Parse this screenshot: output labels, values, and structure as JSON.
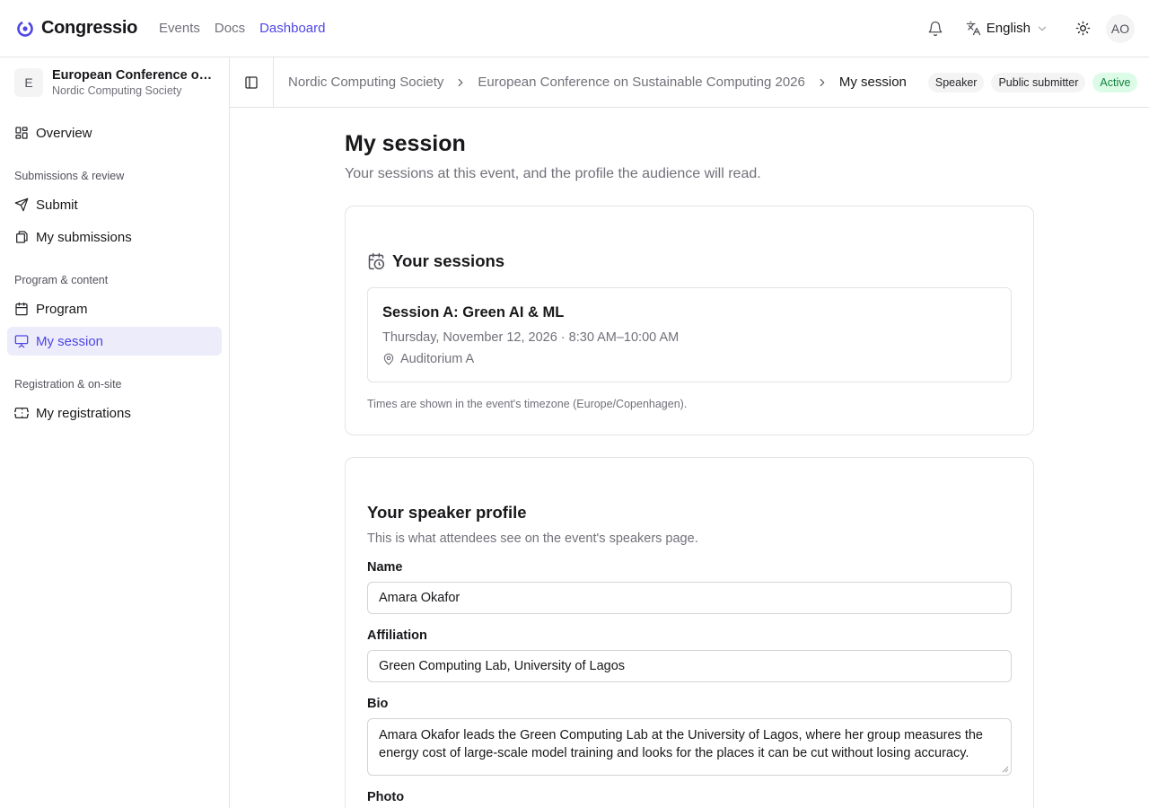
{
  "app": {
    "name": "Congressio"
  },
  "topnav": {
    "events": "Events",
    "docs": "Docs",
    "dashboard": "Dashboard"
  },
  "header": {
    "language": "English",
    "avatar_initials": "AO"
  },
  "sidebar": {
    "event_initial": "E",
    "event_name": "European Conference on Sustainable Computing 2026",
    "event_org": "Nordic Computing Society",
    "overview": "Overview",
    "group_submissions": "Submissions & review",
    "submit": "Submit",
    "my_submissions": "My submissions",
    "group_program": "Program & content",
    "program": "Program",
    "my_session": "My session",
    "group_registration": "Registration & on-site",
    "my_registrations": "My registrations"
  },
  "breadcrumb": {
    "org": "Nordic Computing Society",
    "event": "European Conference on Sustainable Computing 2026",
    "current": "My session"
  },
  "badges": {
    "speaker": "Speaker",
    "public_submitter": "Public submitter",
    "active": "Active"
  },
  "page": {
    "title": "My session",
    "subtitle": "Your sessions at this event, and the profile the audience will read."
  },
  "sessions": {
    "title": "Your sessions",
    "items": [
      {
        "title": "Session A: Green AI & ML",
        "time": "Thursday, November 12, 2026 · 8:30 AM–10:00 AM",
        "room": "Auditorium A"
      }
    ],
    "timezone_note": "Times are shown in the event's timezone (Europe/Copenhagen)."
  },
  "profile": {
    "title": "Your speaker profile",
    "subtitle": "This is what attendees see on the event's speakers page.",
    "name_label": "Name",
    "name_value": "Amara Okafor",
    "affiliation_label": "Affiliation",
    "affiliation_value": "Green Computing Lab, University of Lagos",
    "bio_label": "Bio",
    "bio_value": "Amara Okafor leads the Green Computing Lab at the University of Lagos, where her group measures the energy cost of large-scale model training and looks for the places it can be cut without losing accuracy.",
    "photo_label": "Photo"
  },
  "colors": {
    "accent": "#4f46e5",
    "active_bg": "#ececfb",
    "success": "#15803d"
  }
}
